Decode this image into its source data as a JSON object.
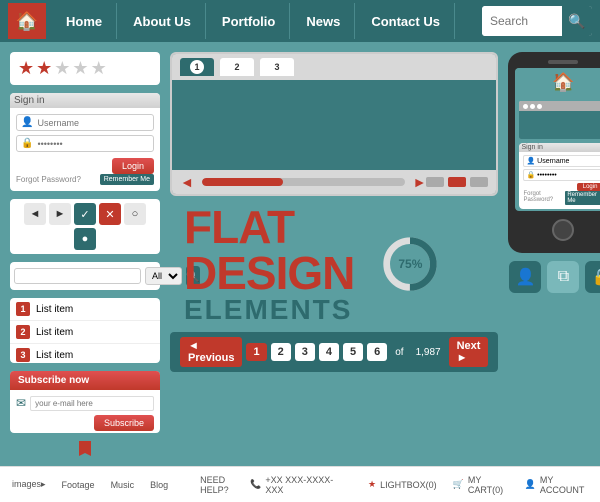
{
  "navbar": {
    "logo_icon": "🏠",
    "items": [
      {
        "label": "Home",
        "id": "home"
      },
      {
        "label": "About Us",
        "id": "about"
      },
      {
        "label": "Portfolio",
        "id": "portfolio"
      },
      {
        "label": "News",
        "id": "news"
      },
      {
        "label": "Contact Us",
        "id": "contact"
      }
    ],
    "search_placeholder": "Search"
  },
  "stars": {
    "filled": 2,
    "empty": 3
  },
  "login": {
    "title": "Sign in",
    "username_placeholder": "Username",
    "password_placeholder": "••••••••",
    "login_btn": "Login",
    "forgot_label": "Forgot Password?",
    "remember_label": "Remember Me"
  },
  "nav_controls": {
    "buttons": [
      "◄",
      "►",
      "✓",
      "✕",
      "○",
      "●"
    ]
  },
  "search": {
    "placeholder": "",
    "filter": "All",
    "icon": "🔍"
  },
  "list_items": [
    {
      "num": "1",
      "label": "List item"
    },
    {
      "num": "2",
      "label": "List item"
    },
    {
      "num": "3",
      "label": "List item"
    }
  ],
  "subscribe": {
    "header": "Subscribe now",
    "email_placeholder": "your e-mail here",
    "btn_label": "Subscribe"
  },
  "browser": {
    "tabs": [
      "1",
      "2",
      "3"
    ]
  },
  "flat_design": {
    "line1": "FLAT",
    "line2": "DESIGN",
    "line3": "ELEMENTS"
  },
  "donut": {
    "percent": 75,
    "label": "75%"
  },
  "pagination": {
    "prev": "◄ Previous",
    "pages": [
      "1",
      "2",
      "3",
      "4",
      "5",
      "6"
    ],
    "active_page": "1",
    "of_label": "of",
    "total": "1,987",
    "next": "Next ►"
  },
  "phone": {
    "login": {
      "title": "Sign in",
      "username": "Username",
      "password": "••••••••",
      "login_btn": "Login",
      "forgot": "Forgot Password?",
      "remember": "Remember Me"
    }
  },
  "icon_buttons": [
    {
      "icon": "👤",
      "id": "user"
    },
    {
      "icon": "⧉",
      "id": "copy"
    },
    {
      "icon": "🔒",
      "id": "lock"
    }
  ],
  "footer": {
    "links": [
      "images▸",
      "Footage",
      "Music",
      "Blog"
    ],
    "need_help": "NEED HELP?",
    "phone": "+XX XXX-XXXX-XXX",
    "lightbox": "LIGHTBOX(0)",
    "cart": "MY CART(0)",
    "account": "MY ACCOUNT"
  }
}
